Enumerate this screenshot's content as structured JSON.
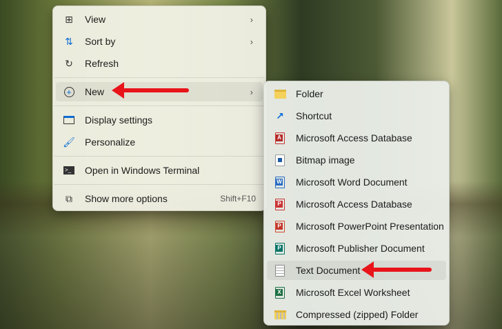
{
  "context_menu": {
    "items": [
      {
        "label": "View",
        "icon": "grid-icon",
        "submenu": true
      },
      {
        "label": "Sort by",
        "icon": "sort-icon",
        "submenu": true
      },
      {
        "label": "Refresh",
        "icon": "refresh-icon"
      },
      {
        "label": "New",
        "icon": "plus-circle-icon",
        "submenu": true
      },
      {
        "label": "Display settings",
        "icon": "display-icon"
      },
      {
        "label": "Personalize",
        "icon": "brush-icon"
      },
      {
        "label": "Open in Windows Terminal",
        "icon": "terminal-icon"
      },
      {
        "label": "Show more options",
        "icon": "expand-icon",
        "shortcut": "Shift+F10"
      }
    ]
  },
  "new_submenu": {
    "items": [
      {
        "label": "Folder"
      },
      {
        "label": "Shortcut"
      },
      {
        "label": "Microsoft Access Database"
      },
      {
        "label": "Bitmap image"
      },
      {
        "label": "Microsoft Word Document"
      },
      {
        "label": "Microsoft Access Database"
      },
      {
        "label": "Microsoft PowerPoint Presentation"
      },
      {
        "label": "Microsoft Publisher Document"
      },
      {
        "label": "Text Document"
      },
      {
        "label": "Microsoft Excel Worksheet"
      },
      {
        "label": "Compressed (zipped) Folder"
      }
    ]
  },
  "colors": {
    "annotation_arrow": "#e8141a",
    "accent": "#0a6cd6"
  }
}
